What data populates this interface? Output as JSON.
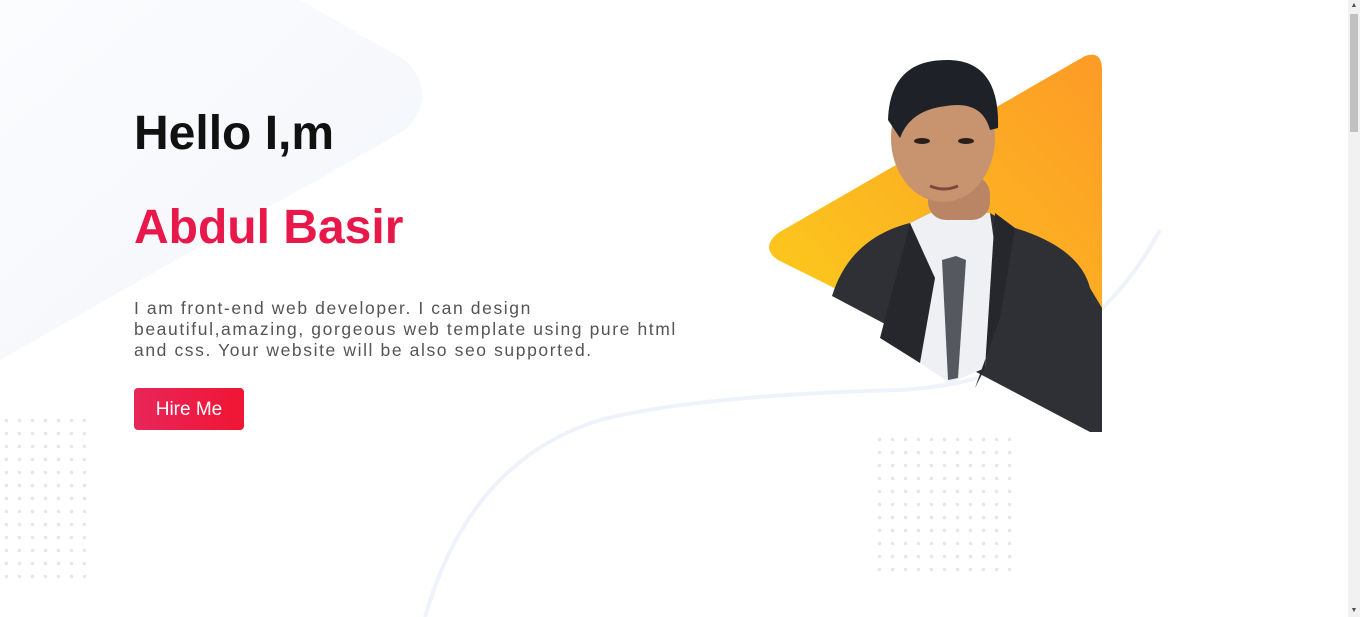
{
  "hero": {
    "greeting": "Hello I,m",
    "name": "Abdul Basir",
    "intro": "I am front-end web developer. I can design beautiful,amazing, gorgeous web template using pure html and css. Your website will be also seo supported.",
    "cta_label": "Hire Me"
  },
  "colors": {
    "accent": "#e8184b",
    "triangle_start": "#fcd21a",
    "triangle_end": "#fd9a27",
    "heading": "#111111",
    "body_text": "#555555"
  },
  "icons": {
    "scroll_up": "▲",
    "scroll_down": "▼"
  }
}
